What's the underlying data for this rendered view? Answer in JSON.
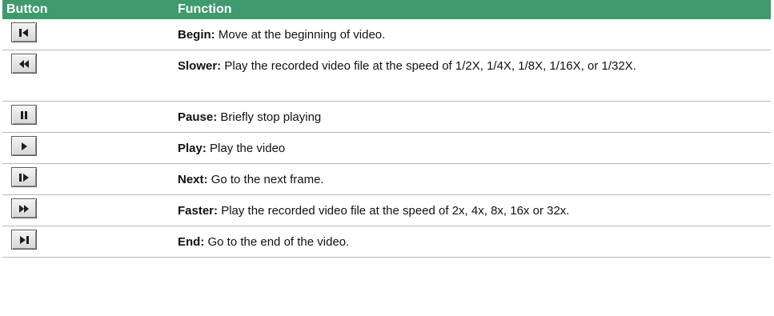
{
  "table": {
    "header": {
      "button": "Button",
      "function": "Function"
    },
    "rows": [
      {
        "icon": "skip-to-begin-icon",
        "name": "Begin:",
        "desc": "Move at the beginning of video."
      },
      {
        "icon": "rewind-slower-icon",
        "name": "Slower:",
        "desc": "Play the recorded video file at the speed of 1/2X, 1/4X, 1/8X, 1/16X, or 1/32X."
      },
      {
        "icon": "pause-icon",
        "name": "Pause:",
        "desc": "Briefly stop playing"
      },
      {
        "icon": "play-icon",
        "name": "Play:",
        "desc": "Play the video"
      },
      {
        "icon": "next-frame-icon",
        "name": "Next:",
        "desc": "Go to the next frame."
      },
      {
        "icon": "fast-forward-icon",
        "name": "Faster:",
        "desc": "Play the recorded video file at the speed of 2x, 4x, 8x, 16x or 32x."
      },
      {
        "icon": "skip-to-end-icon",
        "name": "End:",
        "desc": "Go to the end of the video."
      }
    ]
  },
  "colors": {
    "header_bg": "#3f9a6e",
    "header_text": "#ffffff",
    "icon_fill": "#1e1e1e"
  }
}
